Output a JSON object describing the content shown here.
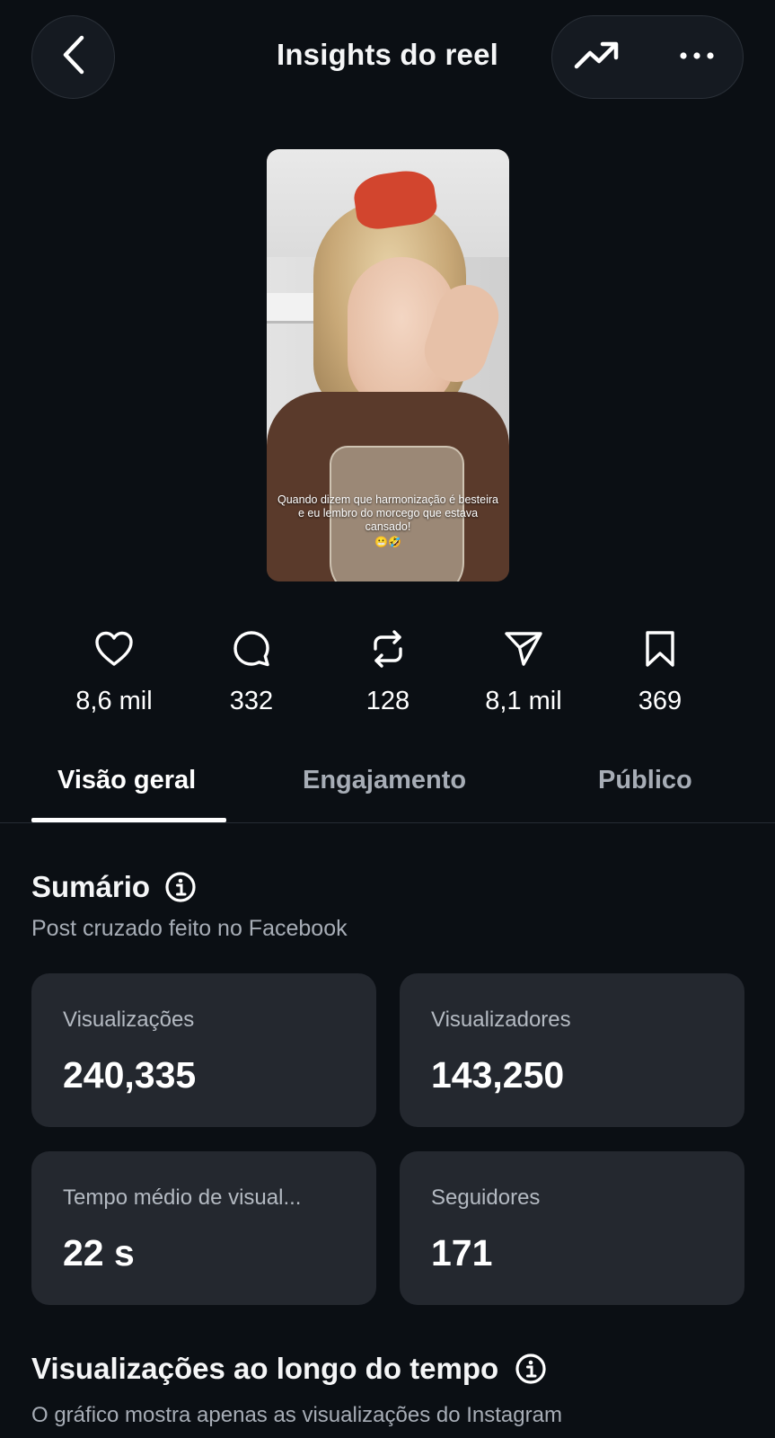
{
  "header": {
    "title": "Insights do reel"
  },
  "thumbnail": {
    "caption": "Quando dizem que harmonização é besteira e eu lembro do morcego que estava cansado!",
    "emojis": "😬🤣"
  },
  "stats": [
    {
      "icon": "heart-icon",
      "value": "8,6 mil"
    },
    {
      "icon": "comment-icon",
      "value": "332"
    },
    {
      "icon": "repost-icon",
      "value": "128"
    },
    {
      "icon": "send-icon",
      "value": "8,1 mil"
    },
    {
      "icon": "bookmark-icon",
      "value": "369"
    }
  ],
  "tabs": [
    {
      "label": "Visão geral",
      "active": true
    },
    {
      "label": "Engajamento",
      "active": false
    },
    {
      "label": "Público",
      "active": false
    }
  ],
  "summary": {
    "title": "Sumário",
    "subtitle": "Post cruzado feito no Facebook",
    "cards": [
      {
        "label": "Visualizações",
        "value": "240,335"
      },
      {
        "label": "Visualizadores",
        "value": "143,250"
      },
      {
        "label": "Tempo médio de visual...",
        "value": "22 s"
      },
      {
        "label": "Seguidores",
        "value": "171"
      }
    ]
  },
  "views_over_time": {
    "title": "Visualizações ao longo do tempo",
    "subtitle": "O gráfico mostra apenas as visualizações do Instagram"
  },
  "colors": {
    "background": "#0b0f14",
    "card": "#24282f",
    "muted_text": "#a7adb6",
    "accent_thumbnail_bow": "#d2452e"
  }
}
